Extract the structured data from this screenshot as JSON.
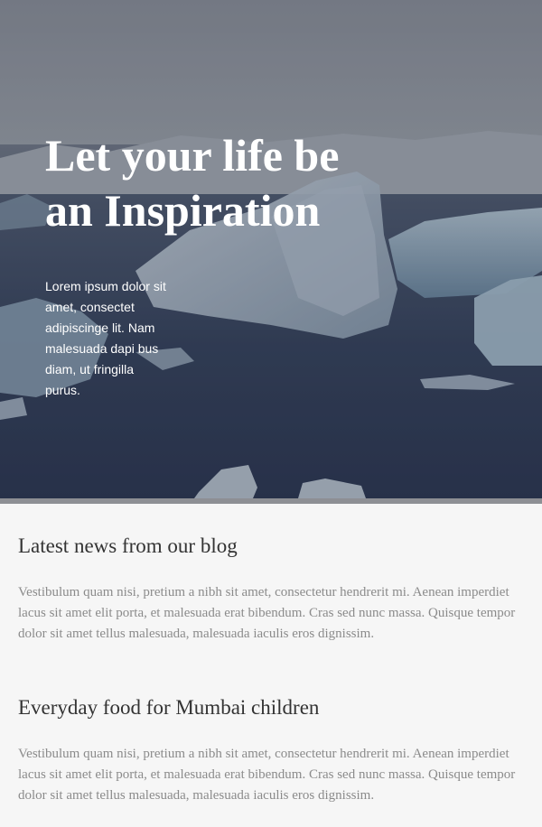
{
  "hero": {
    "title_line1": "Let your life be",
    "title_line2": "an Inspiration",
    "body": "Lorem ipsum dolor sit amet, consectet adipiscinge lit. Nam malesuada dapi bus diam, ut fringilla purus.",
    "image_icon": "iceberg-landscape-image"
  },
  "blog": {
    "posts": [
      {
        "title": "Latest news from our blog",
        "text": "Vestibulum quam nisi, pretium a nibh sit amet, consectetur hendrerit mi. Aenean imperdiet lacus sit amet elit porta, et malesuada erat bibendum. Cras sed nunc massa. Quisque tempor dolor sit amet tellus malesuada, malesuada iaculis eros dignissim."
      },
      {
        "title": "Everyday food for Mumbai children",
        "text": "Vestibulum quam nisi, pretium a nibh sit amet, consectetur hendrerit mi. Aenean imperdiet lacus sit amet elit porta, et malesuada erat bibendum. Cras sed nunc massa. Quisque tempor dolor sit amet tellus malesuada, malesuada iaculis eros dignissim."
      }
    ]
  },
  "colors": {
    "hero_text": "#ffffff",
    "post_title": "#333333",
    "post_text": "#8b8b8b",
    "page_bg": "#f6f6f6",
    "divider": "#8d8f94"
  }
}
